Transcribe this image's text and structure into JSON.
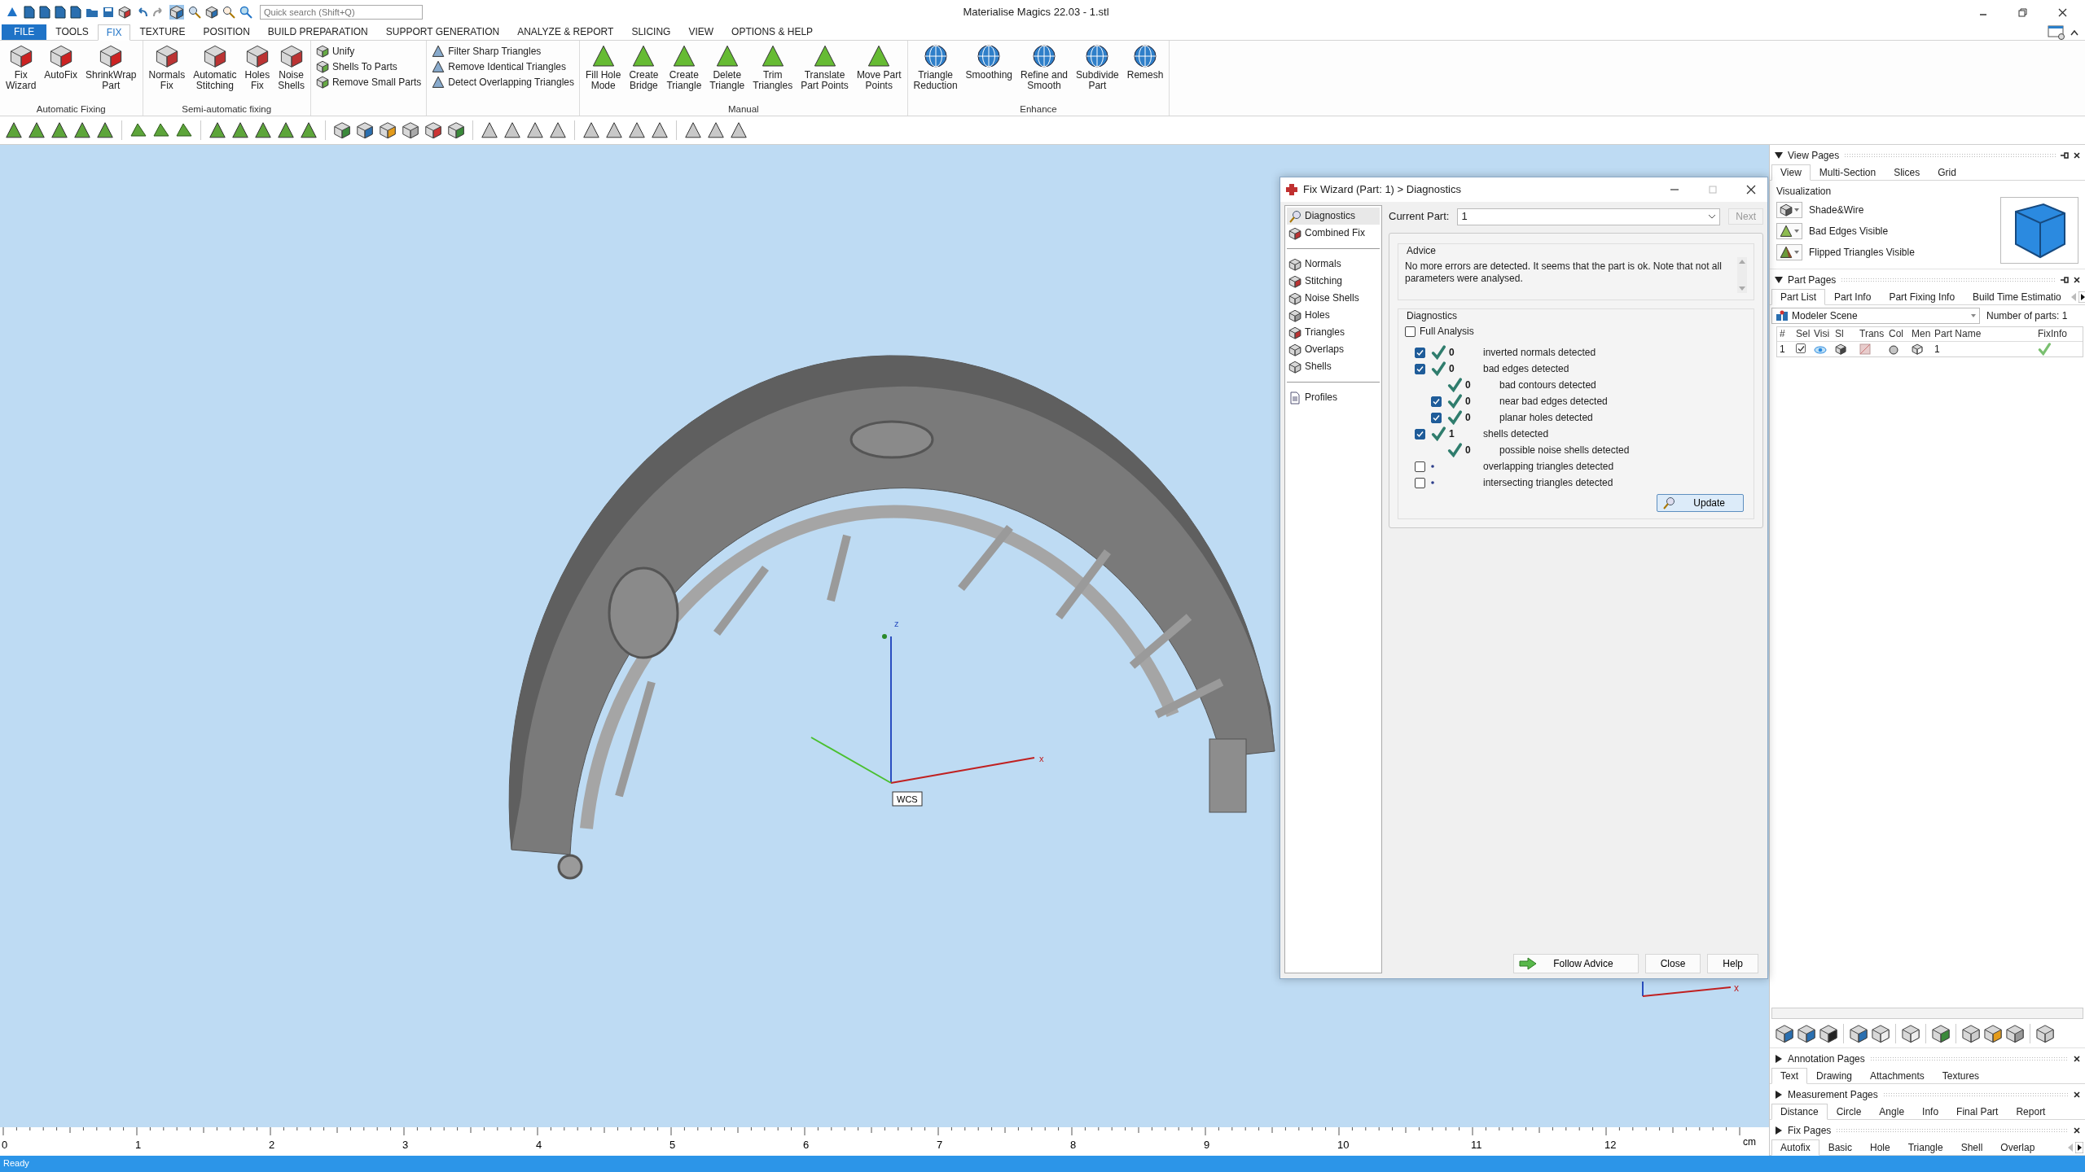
{
  "window": {
    "title": "Materialise Magics 22.03 - 1.stl"
  },
  "quick_search": {
    "placeholder": "Quick search (Shift+Q)"
  },
  "menu_tabs": [
    {
      "label": "FILE",
      "kind": "file",
      "selected": false
    },
    {
      "label": "TOOLS",
      "kind": "tab",
      "selected": false
    },
    {
      "label": "FIX",
      "kind": "tab",
      "selected": true
    },
    {
      "label": "TEXTURE",
      "kind": "tab",
      "selected": false
    },
    {
      "label": "POSITION",
      "kind": "tab",
      "selected": false
    },
    {
      "label": "BUILD PREPARATION",
      "kind": "tab",
      "selected": false
    },
    {
      "label": "SUPPORT GENERATION",
      "kind": "tab",
      "selected": false
    },
    {
      "label": "ANALYZE & REPORT",
      "kind": "tab",
      "selected": false
    },
    {
      "label": "SLICING",
      "kind": "tab",
      "selected": false
    },
    {
      "label": "VIEW",
      "kind": "tab",
      "selected": false
    },
    {
      "label": "OPTIONS & HELP",
      "kind": "tab",
      "selected": false
    }
  ],
  "ribbon_groups": [
    {
      "label": "Automatic Fixing",
      "kind": "large",
      "buttons": [
        {
          "lines": [
            "Fix",
            "Wizard"
          ]
        },
        {
          "lines": [
            "AutoFix"
          ]
        },
        {
          "lines": [
            "ShrinkWrap",
            "Part"
          ]
        }
      ]
    },
    {
      "label": "Semi-automatic fixing",
      "kind": "large",
      "buttons": [
        {
          "lines": [
            "Normals",
            "Fix"
          ]
        },
        {
          "lines": [
            "Automatic",
            "Stitching"
          ]
        },
        {
          "lines": [
            "Holes",
            "Fix"
          ]
        },
        {
          "lines": [
            "Noise",
            "Shells"
          ]
        }
      ]
    },
    {
      "kind": "small",
      "buttons": [
        {
          "lines": [
            "Unify"
          ]
        },
        {
          "lines": [
            "Shells To Parts"
          ]
        },
        {
          "lines": [
            "Remove Small Parts"
          ]
        }
      ]
    },
    {
      "kind": "small",
      "buttons": [
        {
          "lines": [
            "Filter Sharp Triangles"
          ]
        },
        {
          "lines": [
            "Remove Identical Triangles"
          ]
        },
        {
          "lines": [
            "Detect Overlapping Triangles"
          ]
        }
      ]
    },
    {
      "label": "Manual",
      "kind": "large",
      "buttons": [
        {
          "lines": [
            "Fill Hole",
            "Mode"
          ]
        },
        {
          "lines": [
            "Create",
            "Bridge"
          ]
        },
        {
          "lines": [
            "Create",
            "Triangle"
          ]
        },
        {
          "lines": [
            "Delete",
            "Triangle"
          ]
        },
        {
          "lines": [
            "Trim",
            "Triangles"
          ]
        },
        {
          "lines": [
            "Translate",
            "Part Points"
          ]
        },
        {
          "lines": [
            "Move Part",
            "Points"
          ]
        }
      ]
    },
    {
      "label": "Enhance",
      "kind": "large",
      "buttons": [
        {
          "lines": [
            "Triangle",
            "Reduction"
          ]
        },
        {
          "lines": [
            "Smoothing"
          ]
        },
        {
          "lines": [
            "Refine and",
            "Smooth"
          ]
        },
        {
          "lines": [
            "Subdivide",
            "Part"
          ]
        },
        {
          "lines": [
            "Remesh"
          ]
        }
      ]
    }
  ],
  "viewport": {
    "axis_labels": [
      {
        "label": "z",
        "kind": "z"
      },
      {
        "label": "x",
        "kind": "x"
      }
    ],
    "origin_label": "WCS",
    "corner_axis_label": "x"
  },
  "ruler": {
    "labels": [
      "0",
      "1",
      "2",
      "3",
      "4",
      "5",
      "6",
      "7",
      "8",
      "9",
      "10",
      "11",
      "12"
    ],
    "unit": "cm"
  },
  "dialog": {
    "title": "Fix Wizard (Part: 1) > Diagnostics",
    "nav_groups": [
      [
        {
          "label": "Diagnostics",
          "selected": true
        },
        {
          "label": "Combined Fix",
          "selected": false
        }
      ],
      [
        {
          "label": "Normals",
          "selected": false
        },
        {
          "label": "Stitching",
          "selected": false
        },
        {
          "label": "Noise Shells",
          "selected": false
        },
        {
          "label": "Holes",
          "selected": false
        },
        {
          "label": "Triangles",
          "selected": false
        },
        {
          "label": "Overlaps",
          "selected": false
        },
        {
          "label": "Shells",
          "selected": false
        }
      ],
      [
        {
          "label": "Profiles",
          "selected": false
        }
      ]
    ],
    "current_part": {
      "label": "Current Part:",
      "value": "1"
    },
    "next_button": {
      "label": "Next",
      "disabled": true
    },
    "advice": {
      "legend": "Advice",
      "text": "No more errors are detected. It seems that the part is ok. Note that not all parameters were analysed."
    },
    "diagnostics": {
      "legend": "Diagnostics",
      "full_analysis": {
        "label": "Full Analysis",
        "checked": false
      },
      "rows": [
        {
          "kind": "checkbox",
          "checked": true,
          "ok": true,
          "count": "0",
          "text": "inverted normals detected"
        },
        {
          "kind": "checkbox",
          "checked": true,
          "ok": true,
          "count": "0",
          "text": "bad edges detected",
          "children": [
            {
              "kind": "plain",
              "ok": true,
              "count": "0",
              "text": "bad contours detected"
            },
            {
              "kind": "checkbox",
              "checked": true,
              "ok": true,
              "count": "0",
              "text": "near bad edges detected"
            },
            {
              "kind": "checkbox",
              "checked": true,
              "ok": true,
              "count": "0",
              "text": "planar holes detected"
            }
          ]
        },
        {
          "kind": "checkbox",
          "checked": true,
          "ok": true,
          "count": "1",
          "text": "shells detected",
          "children": [
            {
              "kind": "plain",
              "ok": true,
              "count": "0",
              "text": "possible noise shells detected"
            }
          ]
        },
        {
          "kind": "checkbox",
          "checked": false,
          "ok": false,
          "text": "overlapping triangles detected"
        },
        {
          "kind": "checkbox",
          "checked": false,
          "ok": false,
          "text": "intersecting triangles detected"
        }
      ],
      "update_button": "Update"
    },
    "buttons": [
      {
        "label": "Follow Advice",
        "kind": "advice"
      },
      {
        "label": "Close",
        "kind": "plain"
      },
      {
        "label": "Help",
        "kind": "plain"
      }
    ]
  },
  "view_pages": {
    "title": "View Pages",
    "expanded": true,
    "tabs": [
      {
        "label": "View",
        "selected": true
      },
      {
        "label": "Multi-Section",
        "selected": false
      },
      {
        "label": "Slices",
        "selected": false
      },
      {
        "label": "Grid",
        "selected": false
      }
    ],
    "section_label": "Visualization",
    "options": [
      {
        "label": "Shade&Wire",
        "kind": "shade"
      },
      {
        "label": "Bad Edges Visible",
        "kind": "edges"
      },
      {
        "label": "Flipped Triangles Visible",
        "kind": "flipped"
      }
    ]
  },
  "part_pages": {
    "title": "Part Pages",
    "expanded": true,
    "tabs": [
      {
        "label": "Part List",
        "selected": true
      },
      {
        "label": "Part Info",
        "selected": false
      },
      {
        "label": "Part Fixing Info",
        "selected": false
      },
      {
        "label": "Build Time Estimatio",
        "selected": false
      }
    ],
    "scene": "Modeler Scene",
    "count_label": "Number of parts: 1",
    "columns": [
      "#",
      "Sel",
      "Visi",
      "Sl",
      "Trans",
      "Col",
      "Men",
      "Part Name",
      "FixInfo"
    ],
    "rows": [
      {
        "number": "1",
        "checked": true,
        "visible": true,
        "color": "#c4c4c4",
        "name": "1",
        "fixed": true
      }
    ]
  },
  "collapsed_pages": [
    {
      "title": "Annotation Pages",
      "expanded": false,
      "tabs": [
        {
          "label": "Text",
          "selected": true
        },
        {
          "label": "Drawing",
          "selected": false
        },
        {
          "label": "Attachments",
          "selected": false
        },
        {
          "label": "Textures",
          "selected": false
        }
      ]
    },
    {
      "title": "Measurement Pages",
      "expanded": false,
      "tabs": [
        {
          "label": "Distance",
          "selected": true
        },
        {
          "label": "Circle",
          "selected": false
        },
        {
          "label": "Angle",
          "selected": false
        },
        {
          "label": "Info",
          "selected": false
        },
        {
          "label": "Final Part",
          "selected": false
        },
        {
          "label": "Report",
          "selected": false
        }
      ]
    },
    {
      "title": "Fix Pages",
      "expanded": false,
      "tabs": [
        {
          "label": "Autofix",
          "selected": true
        },
        {
          "label": "Basic",
          "selected": false
        },
        {
          "label": "Hole",
          "selected": false
        },
        {
          "label": "Triangle",
          "selected": false
        },
        {
          "label": "Shell",
          "selected": false
        },
        {
          "label": "Overlap",
          "selected": false
        }
      ]
    }
  ],
  "status_bar": {
    "text": "Ready"
  }
}
